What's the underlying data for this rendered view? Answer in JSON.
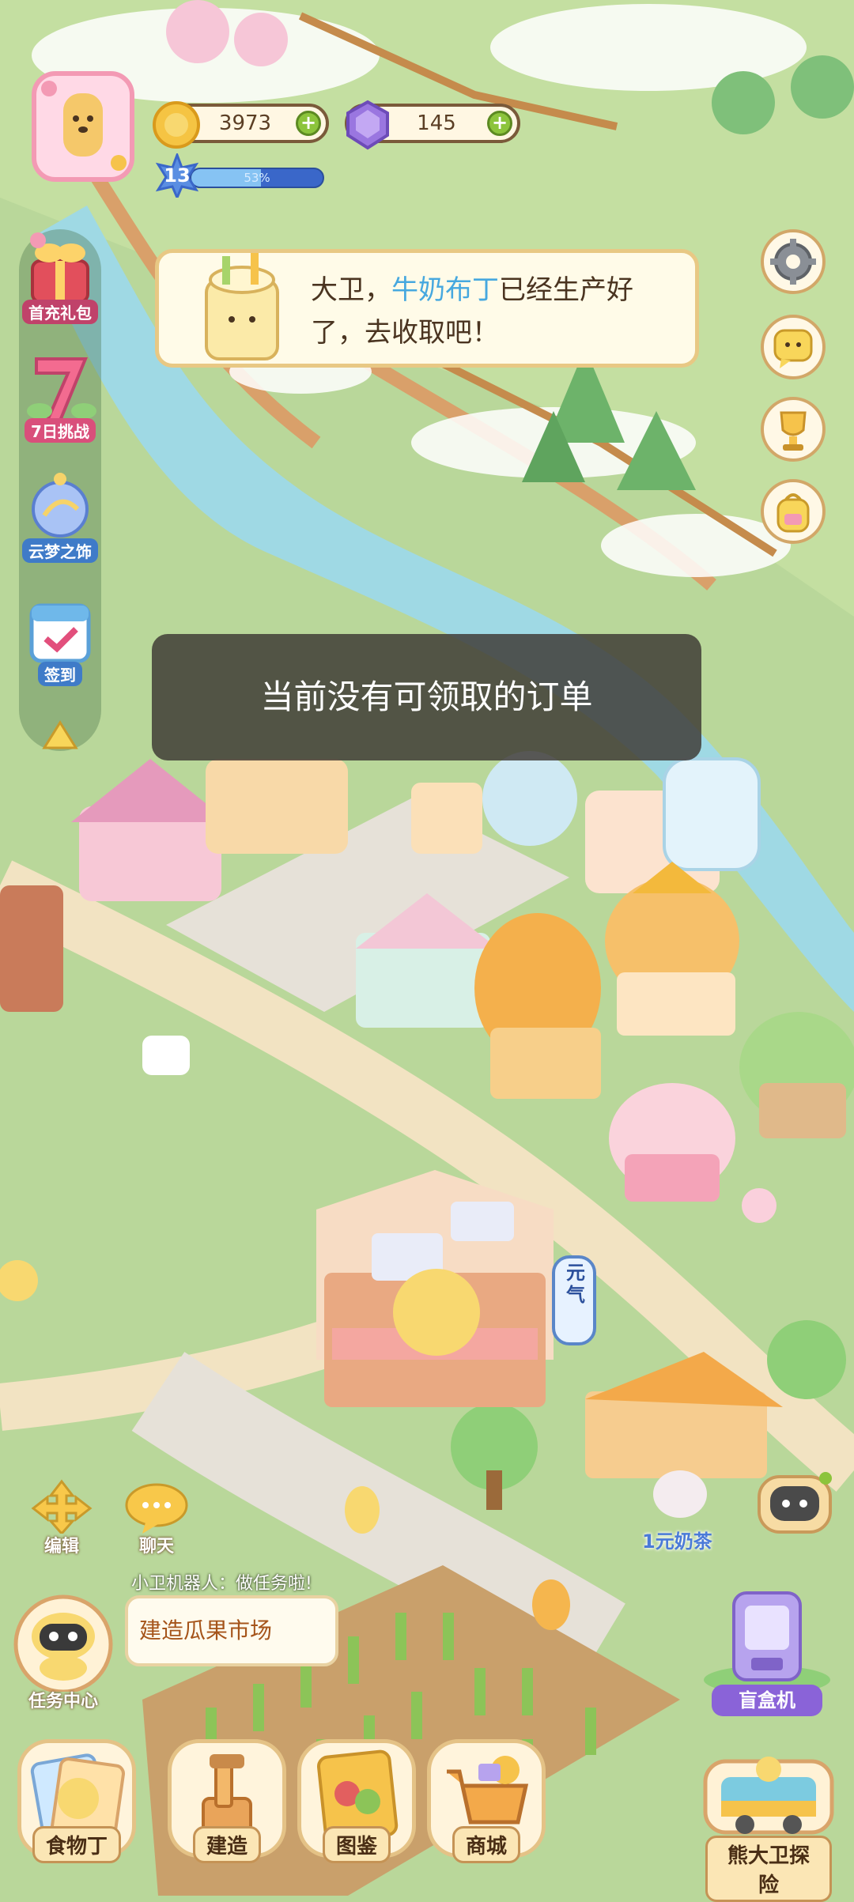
{
  "currency": {
    "coins": "3973",
    "gems": "145"
  },
  "level": {
    "number": "13",
    "progress_text": "53%",
    "progress": 0.53
  },
  "banner": {
    "name": "大卫，",
    "product": "牛奶布丁",
    "message": "已经生产好了，去收取吧！"
  },
  "toast": {
    "text": "当前没有可领取的订单"
  },
  "sidebar": {
    "items": [
      {
        "label": "首充礼包",
        "icon": "gift-icon"
      },
      {
        "label": "7日挑战",
        "icon": "seven-day-challenge-icon"
      },
      {
        "label": "云梦之饰",
        "icon": "cloud-dream-ornament-icon"
      },
      {
        "label": "签到",
        "icon": "calendar-checkin-icon"
      }
    ],
    "collapse_icon": "triangle-up-icon"
  },
  "right_buttons": [
    {
      "icon": "gear-icon"
    },
    {
      "icon": "chat-icon"
    },
    {
      "icon": "trophy-icon"
    },
    {
      "icon": "backpack-icon"
    }
  ],
  "quick_actions": {
    "edit": "编辑",
    "chat": "聊天"
  },
  "task": {
    "robot_says": "小卫机器人：做任务啦!",
    "current_task": "建造瓜果市场",
    "center_label": "任务中心"
  },
  "map_labels": {
    "milk_tea": "1元奶茶",
    "shop_sign": "元气"
  },
  "bottom_nav": [
    {
      "label": "食物丁",
      "icon": "food-album-icon"
    },
    {
      "label": "建造",
      "icon": "build-icon"
    },
    {
      "label": "图鉴",
      "icon": "collection-book-icon"
    },
    {
      "label": "商城",
      "icon": "shopping-cart-icon"
    }
  ],
  "right_bottom": {
    "blind_box": "盲盒机",
    "explore": "熊大卫探险"
  },
  "colors": {
    "grass": "#b9d79a",
    "river": "#9fd9e4",
    "path": "#f2e3c2",
    "highlight_text": "#46a8df",
    "coin": "#f5c443",
    "gem": "#9a76e0",
    "xp_bar": "#3a67c9"
  }
}
